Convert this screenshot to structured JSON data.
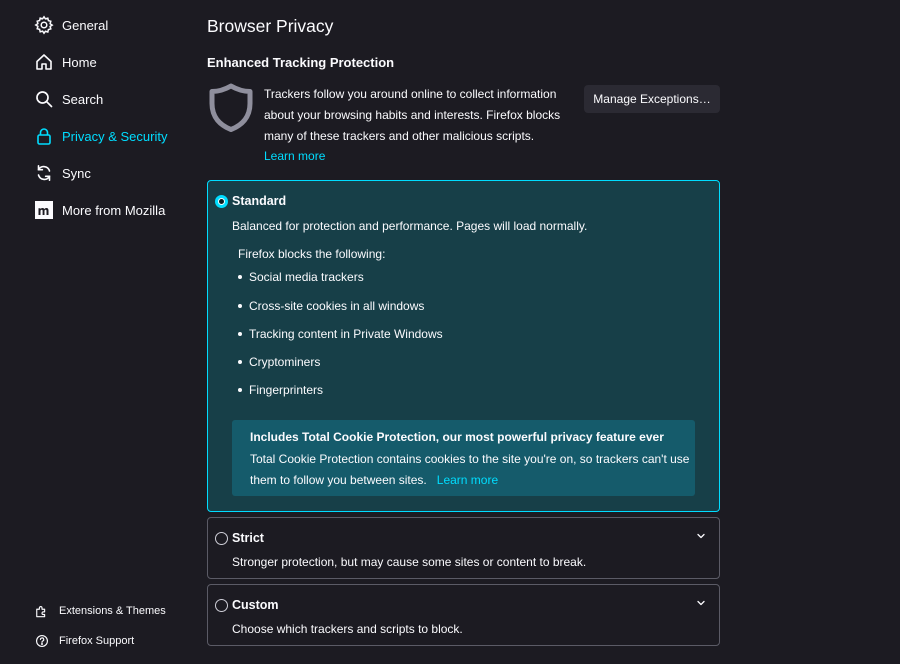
{
  "sidebar": {
    "items": [
      {
        "label": "General",
        "icon": "gear-icon"
      },
      {
        "label": "Home",
        "icon": "home-icon"
      },
      {
        "label": "Search",
        "icon": "search-icon"
      },
      {
        "label": "Privacy & Security",
        "icon": "lock-icon",
        "active": true
      },
      {
        "label": "Sync",
        "icon": "sync-icon"
      },
      {
        "label": "More from Mozilla",
        "icon": "mozilla-icon"
      }
    ],
    "bottom": [
      {
        "label": "Extensions & Themes",
        "icon": "puzzle-icon"
      },
      {
        "label": "Firefox Support",
        "icon": "help-icon"
      }
    ]
  },
  "page": {
    "title": "Browser Privacy",
    "section_title": "Enhanced Tracking Protection",
    "description": "Trackers follow you around online to collect information about your browsing habits and interests. Firefox blocks many of these trackers and other malicious scripts.",
    "learn_more": "Learn more",
    "manage_exceptions": "Manage Exceptions…"
  },
  "options": {
    "standard": {
      "title": "Standard",
      "description": "Balanced for protection and performance. Pages will load normally.",
      "blocks_label": "Firefox blocks the following:",
      "blocks": [
        "Social media trackers",
        "Cross-site cookies in all windows",
        "Tracking content in Private Windows",
        "Cryptominers",
        "Fingerprinters"
      ],
      "tcp_title": "Includes Total Cookie Protection, our most powerful privacy feature ever",
      "tcp_text": "Total Cookie Protection contains cookies to the site you're on, so trackers can't use them to follow you between sites.",
      "tcp_learn_more": "Learn more"
    },
    "strict": {
      "title": "Strict",
      "description": "Stronger protection, but may cause some sites or content to break."
    },
    "custom": {
      "title": "Custom",
      "description": "Choose which trackers and scripts to block."
    }
  },
  "colors": {
    "background": "#1c1b22",
    "accent": "#00ddff",
    "selected_card": "#173f48",
    "info_box": "#155b6b",
    "button": "#2b2a33"
  }
}
